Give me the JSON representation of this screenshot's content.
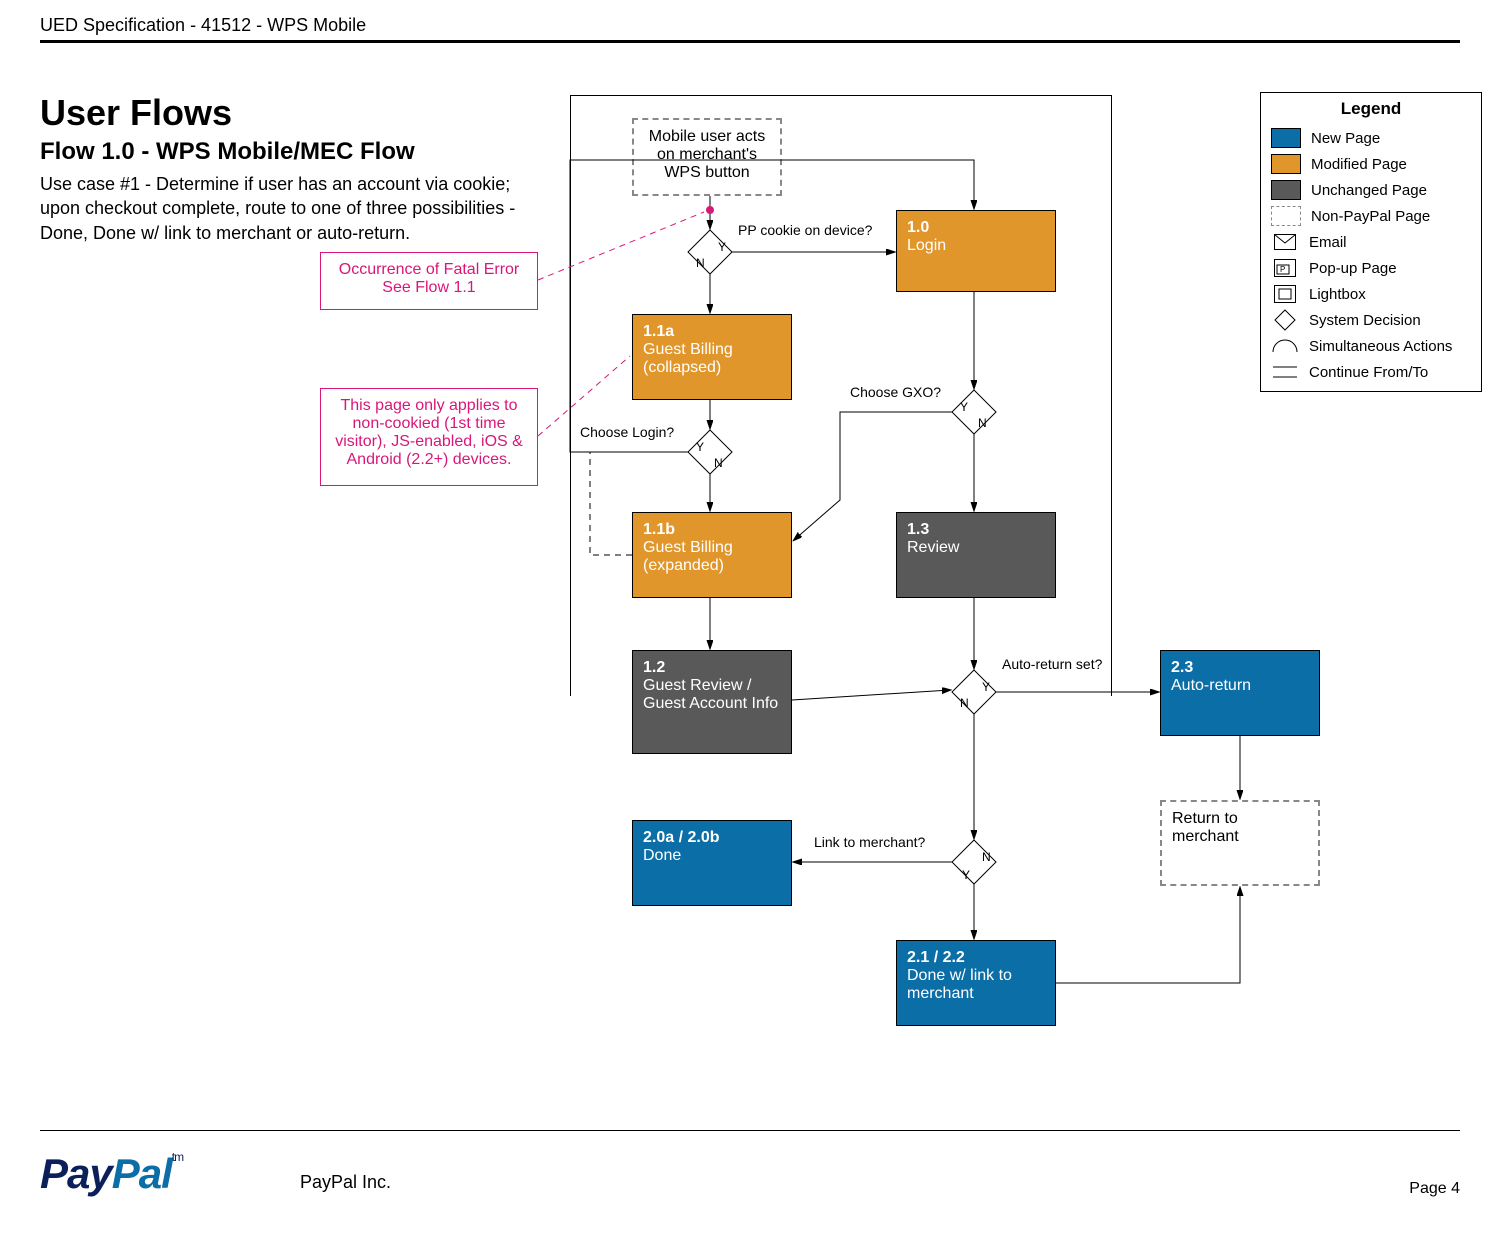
{
  "header": "UED Specification - 41512 - WPS Mobile",
  "title": "User Flows",
  "subtitle": "Flow 1.0 - WPS Mobile/MEC Flow",
  "description": "Use case #1 - Determine if user has an account via cookie; upon checkout complete, route to one of three possibilities - Done, Done w/ link to merchant or auto-return.",
  "notes": {
    "fatal": "Occurrence of Fatal Error\nSee Flow 1.1",
    "applies": "This page only applies to non-cookied (1st time visitor), JS-enabled, iOS & Android (2.2+) devices."
  },
  "boxes": {
    "start": {
      "num": "",
      "label": "Mobile user acts on merchant's WPS button"
    },
    "login": {
      "num": "1.0",
      "label": "Login"
    },
    "gbcol": {
      "num": "1.1a",
      "label": "Guest Billing\n(collapsed)"
    },
    "gbexp": {
      "num": "1.1b",
      "label": "Guest Billing\n(expanded)"
    },
    "greview": {
      "num": "1.2",
      "label": "Guest Review / Guest Account Info"
    },
    "review": {
      "num": "1.3",
      "label": "Review"
    },
    "done": {
      "num": "2.0a / 2.0b",
      "label": "Done"
    },
    "donelink": {
      "num": "2.1 / 2.2",
      "label": "Done w/ link to merchant"
    },
    "autoret": {
      "num": "2.3",
      "label": "Auto-return"
    },
    "retmerch": {
      "num": "",
      "label": "Return to merchant"
    }
  },
  "decisions": {
    "cookie": "PP cookie on device?",
    "chlogin": "Choose Login?",
    "chgxo": "Choose GXO?",
    "autoset": "Auto-return set?",
    "linkmerch": "Link to merchant?"
  },
  "yn": {
    "y": "Y",
    "n": "N"
  },
  "legend": {
    "title": "Legend",
    "items": [
      {
        "kind": "sw",
        "color": "#0b6ea7",
        "label": "New Page"
      },
      {
        "kind": "sw",
        "color": "#e0962a",
        "label": "Modified Page"
      },
      {
        "kind": "sw",
        "color": "#595959",
        "label": "Unchanged Page"
      },
      {
        "kind": "sw-dash",
        "label": "Non-PayPal Page"
      },
      {
        "kind": "email",
        "label": "Email"
      },
      {
        "kind": "popup",
        "label": "Pop-up Page"
      },
      {
        "kind": "lightbox",
        "label": "Lightbox"
      },
      {
        "kind": "diamond",
        "label": "System Decision"
      },
      {
        "kind": "semi",
        "label": "Simultaneous Actions"
      },
      {
        "kind": "cont",
        "label": "Continue From/To"
      }
    ]
  },
  "footer": {
    "company": "PayPal Inc.",
    "page": "Page 4",
    "logo_pay": "Pay",
    "logo_pal": "Pal",
    "tm": "tm"
  }
}
